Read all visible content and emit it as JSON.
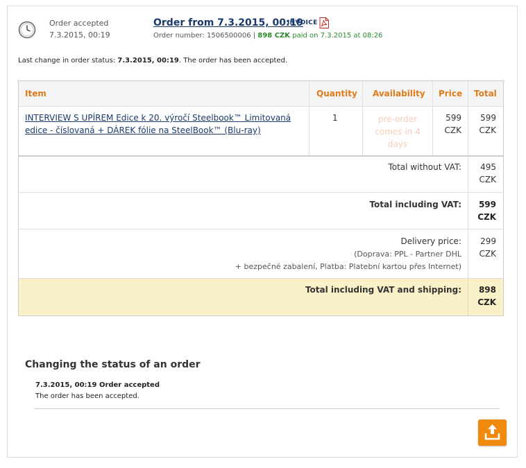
{
  "order": {
    "status_label": "Order accepted",
    "status_date": "7.3.2015, 00:19",
    "title": "Order from 7.3.2015, 00:19",
    "separator": "|",
    "invoice_label": "INVOICE",
    "number_prefix": "Order number: 1506500006 |",
    "paid_amount": "898 CZK",
    "paid_suffix": "paid on 7.3.2015 at 08:26"
  },
  "last_change": {
    "prefix": "Last change in order status:",
    "date": "7.3.2015, 00:19",
    "suffix": ". The order has been accepted."
  },
  "table": {
    "headers": {
      "item": "Item",
      "quantity": "Quantity",
      "availability": "Availability",
      "price": "Price",
      "total": "Total"
    },
    "rows": [
      {
        "item": "INTERVIEW S UPÍREM Edice k 20. výročí Steelbook™ Limitovaná edice - číslovaná + DÁREK fólie na SteelBook™ (Blu-ray)",
        "quantity": "1",
        "availability": "pre-order comes in 4 days",
        "price_value": "599",
        "price_currency": "CZK",
        "total_value": "599",
        "total_currency": "CZK"
      }
    ],
    "total_without_vat": {
      "label": "Total without VAT:",
      "value": "495",
      "currency": "CZK"
    },
    "total_including_vat": {
      "label": "Total including VAT:",
      "value": "599",
      "currency": "CZK"
    },
    "delivery": {
      "label": "Delivery price:",
      "line1": "(Doprava: PPL - Partner DHL",
      "line2": "+ bezpečné zabalení, Platba: Platební kartou přes Internet)",
      "value": "299",
      "currency": "CZK"
    },
    "grand_total": {
      "label": "Total including VAT and shipping:",
      "value": "898",
      "currency": "CZK"
    }
  },
  "history": {
    "title": "Changing the status of an order",
    "entries": [
      {
        "date_status": "7.3.2015, 00:19 Order accepted",
        "text": "The order has been accepted."
      }
    ]
  },
  "icons": {
    "clock": "clock-icon",
    "invoice": "pdf-icon",
    "upload": "upload-icon"
  },
  "colors": {
    "accent": "#e07b1a",
    "link": "#1a3a6e",
    "paid": "#2c8a2c",
    "total_bg": "#fbf1c8",
    "button": "#f08a0c"
  }
}
